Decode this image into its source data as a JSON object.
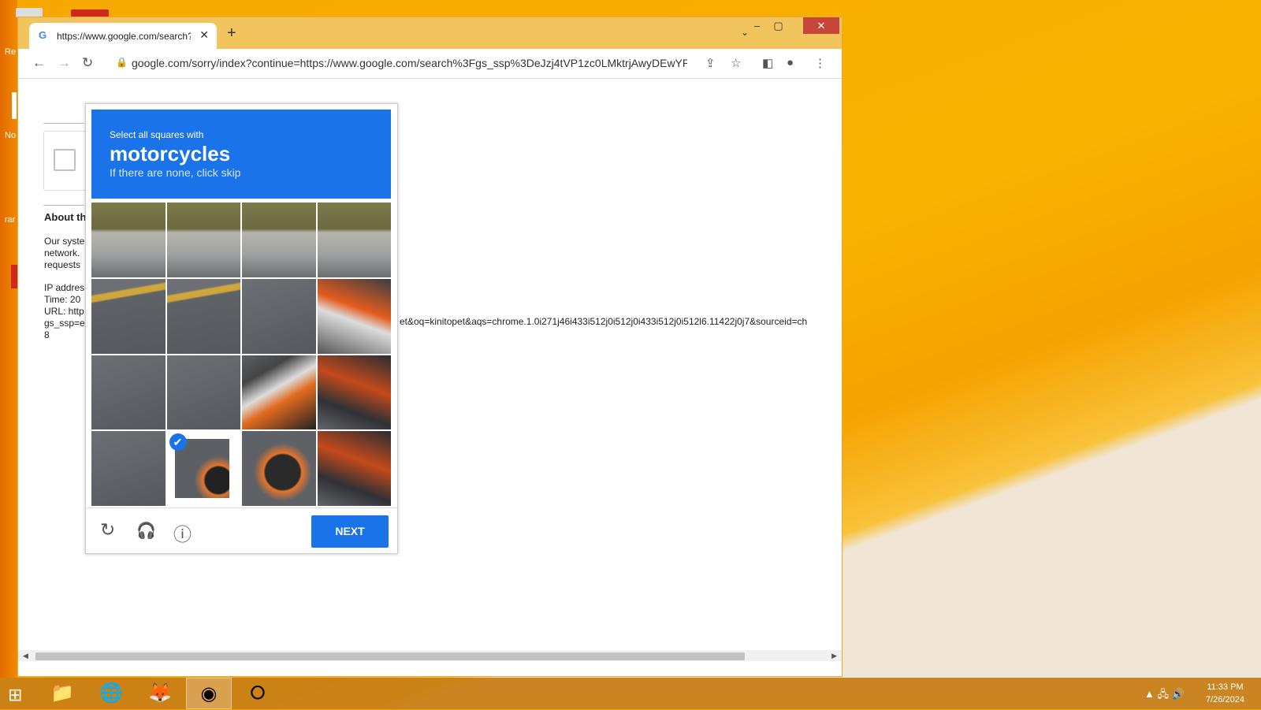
{
  "desktop": {
    "labels": [
      "Re",
      "No",
      "rar"
    ]
  },
  "browser": {
    "tab_title": "https://www.google.com/search?q",
    "tab_close": "✕",
    "new_tab": "+",
    "tab_search": "⌄",
    "window_buttons": {
      "minimize": "–",
      "maximize": "▢",
      "close": "✕"
    },
    "url": "google.com/sorry/index?continue=https://www.google.com/search%3Fgs_ssp%3DeJzj4tVP1zc0LMktrjAwyDEwYPT...",
    "nav": {
      "back": "←",
      "forward": "→",
      "reload": "↻"
    }
  },
  "page": {
    "about_title": "About th",
    "lines": [
      "Our syste",
      "network.",
      "requests"
    ],
    "ip_lines": [
      "IP addres",
      "Time: 20",
      "URL: http",
      "gs_ssp=e",
      "8"
    ],
    "url_tail": "et&oq=kinitopet&aqs=chrome.1.0i271j46i433i512j0i512j0i433i512j0i512l6.11422j0j7&sourceid=ch"
  },
  "captcha": {
    "instruction_line1": "Select all squares with",
    "target": "motorcycles",
    "instruction_line2": "If there are none, click skip",
    "tiles": [
      {
        "type": "grass",
        "selected": false
      },
      {
        "type": "grass",
        "selected": false
      },
      {
        "type": "grass",
        "selected": false
      },
      {
        "type": "grass",
        "selected": false
      },
      {
        "type": "yellowline",
        "selected": false
      },
      {
        "type": "yellowline",
        "selected": false
      },
      {
        "type": "road",
        "selected": false
      },
      {
        "type": "moto1",
        "selected": false
      },
      {
        "type": "road",
        "selected": false
      },
      {
        "type": "road",
        "selected": false
      },
      {
        "type": "moto2",
        "selected": false
      },
      {
        "type": "moto4",
        "selected": false
      },
      {
        "type": "road",
        "selected": false
      },
      {
        "type": "moto3",
        "selected": true
      },
      {
        "type": "moto3",
        "selected": false
      },
      {
        "type": "moto4",
        "selected": false
      }
    ],
    "check_mark": "✔",
    "next_label": "NEXT",
    "icons": {
      "reload": "↻",
      "audio": "🎧",
      "info": "ⓘ"
    }
  },
  "taskbar": {
    "start": "⊞",
    "apps": [
      {
        "name": "file-explorer-icon",
        "glyph": "📁",
        "active": false
      },
      {
        "name": "globe-app-icon",
        "glyph": "🌐",
        "active": false
      },
      {
        "name": "firefox-icon",
        "glyph": "🦊",
        "active": false
      },
      {
        "name": "chrome-icon",
        "glyph": "◉",
        "active": true
      },
      {
        "name": "opera-icon",
        "glyph": "⭘",
        "active": false
      }
    ],
    "tray": "▲  🖧  🔊",
    "time": "11:33 PM",
    "date": "7/26/2024"
  }
}
